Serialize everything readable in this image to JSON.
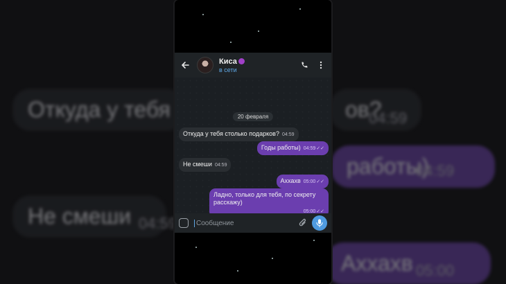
{
  "contact": {
    "name": "Киса",
    "status": "в сети"
  },
  "chat": {
    "date_label": "20 февраля",
    "messages": [
      {
        "direction": "in",
        "text": "Откуда у тебя столько подарков?",
        "time": "04:59"
      },
      {
        "direction": "out",
        "text": "Годы работы)",
        "time": "04:59"
      },
      {
        "direction": "in",
        "text": "Не смеши",
        "time": "04:59"
      },
      {
        "direction": "out",
        "text": "Аххахв",
        "time": "05:00"
      },
      {
        "direction": "out",
        "text": "Ладно, только для тебя, по секрету расскажу)",
        "time": "05:00"
      }
    ]
  },
  "input": {
    "placeholder": "Сообщение"
  },
  "background_echo": {
    "msg1": "Откуда у тебя с",
    "msg1_tail": "ов?",
    "msg1_time": "04:59",
    "msg2": "работы)",
    "msg2_time": "04:59",
    "msg3": "Не смеши",
    "msg3_time": "04:59",
    "msg4": "Аххахв",
    "msg4_time": "05:00"
  },
  "colors": {
    "accent": "#5fa8e6",
    "outgoing_bubble": "#6b3eaf",
    "incoming_bubble": "#2a2e32",
    "header": "#1f2326",
    "mic_button": "#4f9be0"
  },
  "icons": [
    "back-arrow-icon",
    "phone-icon",
    "more-vertical-icon",
    "sticker-icon",
    "attach-icon",
    "microphone-icon",
    "double-check-icon"
  ]
}
